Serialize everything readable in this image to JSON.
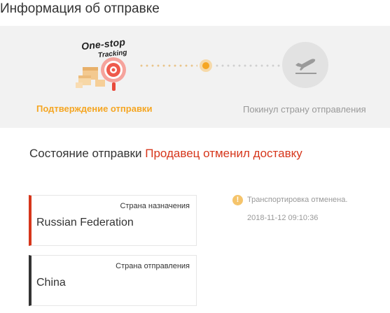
{
  "page": {
    "title": "Информация об отправке"
  },
  "tracker": {
    "logo_line1": "One-stop",
    "logo_line2": "Tracking",
    "steps": [
      {
        "label": "Подтверждение отправки",
        "state": "active",
        "icon": "one-stop-tracking-illustration"
      },
      {
        "label": "Покинул страну отправления",
        "state": "pending",
        "icon": "airplane-departure-icon"
      }
    ],
    "colors": {
      "active": "#f5a623",
      "pending": "#999999",
      "panel_background": "#f2f2f2"
    }
  },
  "status": {
    "label": "Состояние отправки",
    "value": "Продавец отменил доставку",
    "value_color": "#d6361b"
  },
  "destination": {
    "label": "Страна назначения",
    "value": "Russian Federation",
    "accent_color": "#d6361b"
  },
  "origin": {
    "label": "Страна отправления",
    "value": "China",
    "accent_color": "#333333"
  },
  "events": [
    {
      "icon": "exclamation-circle-icon",
      "icon_glyph": "!",
      "text": "Транспортировка отменена.",
      "time": "2018-11-12 09:10:36"
    }
  ]
}
